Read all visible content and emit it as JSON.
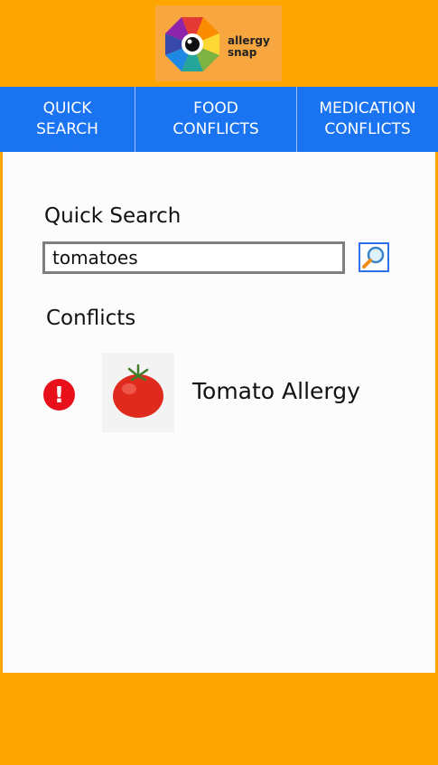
{
  "brand": {
    "logo_text": "allergy\nsnap",
    "colors": {
      "header": "#ffa500",
      "tabs": "#1a73f0",
      "alert": "#e8101b"
    }
  },
  "tabs": [
    {
      "label": "QUICK\nSEARCH",
      "active": true
    },
    {
      "label": "FOOD\nCONFLICTS",
      "active": false
    },
    {
      "label": "MEDICATION\nCONFLICTS",
      "active": false
    }
  ],
  "quick_search": {
    "title": "Quick Search",
    "input_value": "tomatoes",
    "search_icon": "magnifier-icon"
  },
  "conflicts": {
    "title": "Conflicts",
    "items": [
      {
        "icon": "alert-icon",
        "alert_glyph": "!",
        "image": "tomato",
        "name": "Tomato Allergy"
      }
    ]
  }
}
